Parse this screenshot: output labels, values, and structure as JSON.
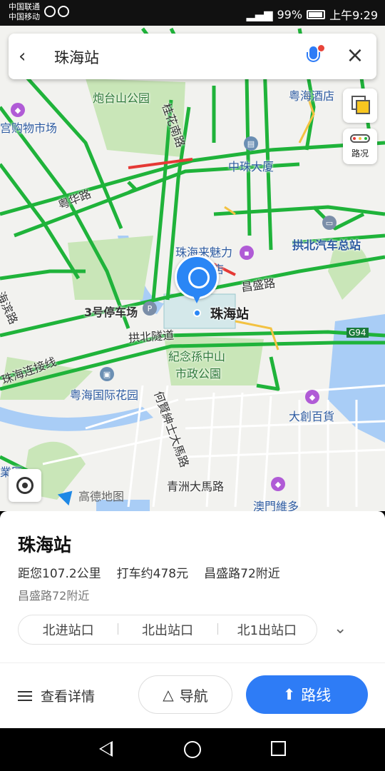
{
  "status_bar": {
    "carrier_1": "中国联通",
    "carrier_2": "中国移动",
    "battery": "99%",
    "time": "上午9:29"
  },
  "search": {
    "query": "珠海站",
    "back_icon": "arrow-left-icon",
    "voice_icon": "microphone-icon",
    "close_icon": "close-icon"
  },
  "map": {
    "labels": {
      "paotaishan": "炮台山公园",
      "guihualu": "桂花南路",
      "yuehaihotel": "粤海酒店",
      "zhongzhu": "中珠大厦",
      "gouwu": "宫购物市场",
      "yuehualu": "粤华路",
      "gongbeibus": "拱北汽车总站",
      "laimeili_1": "珠海来魅力",
      "laimeili_2": "酒店",
      "changshenglu": "昌盛路",
      "parking": "3号停车场",
      "station": "珠海站",
      "gongbeitunnel": "拱北隧道",
      "g94": "G94",
      "haobinlu": "海滨路",
      "lianjiexian": "珠海连接线",
      "sunpark_1": "紀念孫中山",
      "sunpark_2": "市政公園",
      "yuehaigarden": "粤海国际花园",
      "daju": "大創百貨",
      "hexianlu": "何賢紳士大馬路",
      "qingzhou": "青洲大馬路",
      "aomen": "澳門維多",
      "ye": "業區",
      "logo": "高德地图"
    },
    "traffic_label": "路况"
  },
  "poi": {
    "title": "珠海站",
    "distance": "距您107.2公里",
    "taxi": "打车约478元",
    "near": "昌盛路72附近",
    "address": "昌盛路72附近",
    "exits": [
      "北进站口",
      "北出站口",
      "北1出站口"
    ]
  },
  "actions": {
    "details": "查看详情",
    "navigate": "导航",
    "route": "路线"
  },
  "colors": {
    "accent": "#2e7cf6",
    "road_green": "#1fb33a",
    "road_red": "#e53935",
    "water": "#a9cdf6",
    "park": "#c9e6b8"
  }
}
